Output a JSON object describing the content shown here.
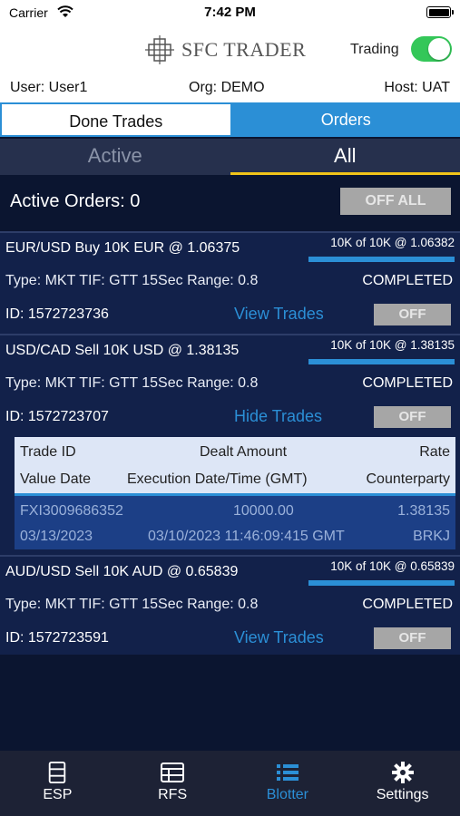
{
  "status_bar": {
    "carrier": "Carrier",
    "time": "7:42 PM"
  },
  "header": {
    "logo_text": "SFC TRADER",
    "trading_label": "Trading",
    "trading_on": true
  },
  "info": {
    "user": "User: User1",
    "org": "Org: DEMO",
    "host": "Host: UAT"
  },
  "segments": {
    "done_trades": "Done Trades",
    "orders": "Orders",
    "selected": "Orders"
  },
  "subtabs": {
    "active": "Active",
    "all": "All",
    "selected": "All"
  },
  "active_orders": {
    "label": "Active Orders: 0",
    "off_all": "OFF ALL"
  },
  "orders": [
    {
      "pair": "EUR/USD Buy 10K EUR @ 1.06375",
      "fill": "10K of 10K @ 1.06382",
      "fill_progress": 1.0,
      "type": "Type: MKT TIF: GTT 15Sec Range: 0.8",
      "status": "COMPLETED",
      "id": "ID: 1572723736",
      "link": "View Trades",
      "off": "OFF"
    },
    {
      "pair": "USD/CAD Sell 10K USD @ 1.38135",
      "fill": "10K of 10K @ 1.38135",
      "fill_progress": 1.0,
      "type": "Type: MKT TIF: GTT 15Sec Range: 0.8",
      "status": "COMPLETED",
      "id": "ID: 1572723707",
      "link": "Hide Trades",
      "off": "OFF"
    },
    {
      "pair": "AUD/USD Sell 10K AUD @ 0.65839",
      "fill": "10K of 10K @ 0.65839",
      "fill_progress": 1.0,
      "type": "Type: MKT TIF: GTT 15Sec Range: 0.8",
      "status": "COMPLETED",
      "id": "ID: 1572723591",
      "link": "View Trades",
      "off": "OFF"
    }
  ],
  "trades_table": {
    "headers": {
      "trade_id": "Trade ID",
      "dealt_amount": "Dealt Amount",
      "rate": "Rate",
      "value_date": "Value Date",
      "execution": "Execution Date/Time (GMT)",
      "counterparty": "Counterparty"
    },
    "rows": [
      {
        "trade_id": "FXI3009686352",
        "dealt_amount": "10000.00",
        "rate": "1.38135",
        "value_date": "03/13/2023",
        "execution": "03/10/2023 11:46:09:415 GMT",
        "counterparty": "BRKJ"
      }
    ]
  },
  "tabbar": [
    {
      "label": "ESP",
      "icon": "esp-icon"
    },
    {
      "label": "RFS",
      "icon": "rfs-icon"
    },
    {
      "label": "Blotter",
      "icon": "blotter-list-icon"
    },
    {
      "label": "Settings",
      "icon": "gear-icon"
    }
  ],
  "colors": {
    "accent": "#2b8fd6",
    "toggle_on": "#34c759",
    "background": "#0b1530",
    "card": "#12214a"
  }
}
